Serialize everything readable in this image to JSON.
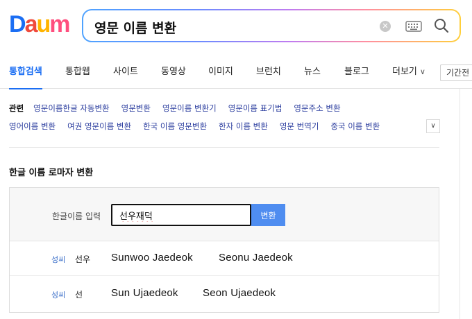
{
  "logo": {
    "letters": [
      "D",
      "a",
      "u",
      "m"
    ],
    "colors": [
      "#1b6ef3",
      "#f04a3c",
      "#ffb400",
      "#ff4e7e"
    ]
  },
  "search": {
    "query": "영문 이름 변환",
    "clear_symbol": "✕"
  },
  "tabs": [
    {
      "label": "통합검색",
      "active": true
    },
    {
      "label": "통합웹"
    },
    {
      "label": "사이트"
    },
    {
      "label": "동영상"
    },
    {
      "label": "이미지"
    },
    {
      "label": "브런치"
    },
    {
      "label": "뉴스"
    },
    {
      "label": "블로그"
    },
    {
      "label": "더보기"
    }
  ],
  "period_button": "기간전",
  "related": {
    "label": "관련",
    "row1": [
      "영문이름한글 자동변환",
      "영문변환",
      "영문이름 변환기",
      "영문이름 표기법",
      "영문주소 변환"
    ],
    "row2": [
      "영어이름 변환",
      "여권 영문이름 변환",
      "한국 이름 영문변환",
      "한자 이름 변환",
      "영문 번역기",
      "중국 이름 변환"
    ]
  },
  "converter": {
    "title": "한글 이름 로마자 변환",
    "input_label": "한글이름 입력",
    "input_value": "선우재덕",
    "button": "변환",
    "results": [
      {
        "tag": "성씨",
        "surname": "선우",
        "romanizations": [
          "Sunwoo Jaedeok",
          "Seonu Jaedeok"
        ]
      },
      {
        "tag": "성씨",
        "surname": "선",
        "romanizations": [
          "Sun Ujaedeok",
          "Seon Ujaedeok"
        ]
      }
    ]
  },
  "accent_color": "#1b6ef3"
}
